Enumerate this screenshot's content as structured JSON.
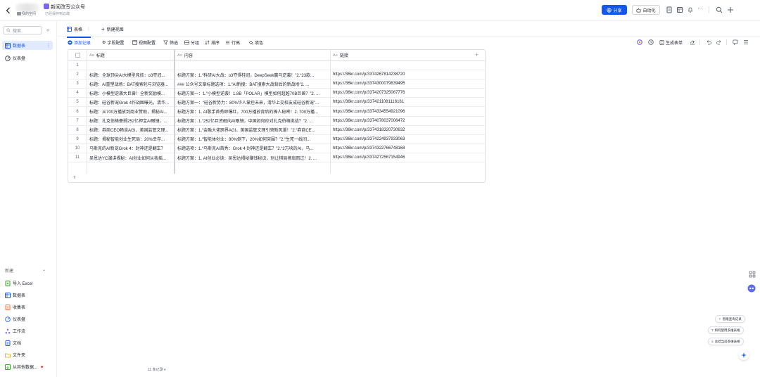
{
  "topbar": {
    "workspace_label": "我的空间",
    "doc_title": "新闻改写公众号",
    "saved_status": "已经保存到云端",
    "share_label": "分享",
    "automation_label": "自动化"
  },
  "sidebar": {
    "search_placeholder": "搜索",
    "items": [
      {
        "label": "数据表",
        "icon": "table-icon",
        "active": true
      },
      {
        "label": "仪表盘",
        "icon": "dashboard-icon",
        "active": false
      }
    ],
    "new_header": "新建",
    "new_items": [
      {
        "label": "导入 Excel",
        "icon": "excel-icon",
        "color": "#2ea121"
      },
      {
        "label": "数据表",
        "icon": "table-icon",
        "color": "#1456f0"
      },
      {
        "label": "收集表",
        "icon": "form-icon",
        "color": "#f77234"
      },
      {
        "label": "仪表盘",
        "icon": "dashboard-icon",
        "color": "#1456f0"
      },
      {
        "label": "工作流",
        "icon": "workflow-icon",
        "color": "#7b67ee"
      },
      {
        "label": "文档",
        "icon": "doc-icon",
        "color": "#1456f0"
      },
      {
        "label": "文件夹",
        "icon": "folder-icon",
        "color": "#f0a000"
      },
      {
        "label": "从其他数据...",
        "icon": "import-icon",
        "color": "#2ea121"
      }
    ]
  },
  "tabs": {
    "active_label": "表格",
    "new_view_label": "新建视图"
  },
  "toolbar": {
    "add_record": "添加记录",
    "field_config": "字段配置",
    "view_config": "视图配置",
    "filter": "筛选",
    "group": "分组",
    "sort": "排序",
    "row_height": "行高",
    "fill_color": "填色",
    "generate_form": "生成表单"
  },
  "table": {
    "columns": [
      {
        "type": "Aa",
        "label": "标题"
      },
      {
        "type": "A≡",
        "label": "内容"
      },
      {
        "type": "A≡",
        "label": "链接"
      }
    ],
    "rows": [
      {
        "num": "1",
        "title": "",
        "content": "",
        "link": ""
      },
      {
        "num": "2",
        "title": "标题：全球顶尖AI大模型竞技：o3夺冠...",
        "content": "标题方案：1.“科研AI大战：o3夺得桂冠，DeepSeek赢马逆袭！”2.“23款...",
        "link": "https://36kr.com/p/3374267814238720"
      },
      {
        "num": "3",
        "title": "标题：AI重塑战场：BAT搜索轮与浏览器...",
        "content": "### 公众号文章标题选项：1.“AI新搜：BAT搜索大战背后的新战场”2. ...",
        "link": "https://36kr.com/p/3374300079839495"
      },
      {
        "num": "4",
        "title": "标题：小模型逆袭大巨兽！全新奖励模...",
        "content": "标题方案一：1.“小模型逆袭！1.8B「POLAR」模型如何超越70B巨兽？”2. ...",
        "link": "https://36kr.com/p/3374207325067776"
      },
      {
        "num": "5",
        "title": "标题：硅谷新宠Grok 4作战图曝光，清华...",
        "content": "标题方案一：“硅谷新势力：80%华人掌控未来，清华上交校友成硅谷新宠”...",
        "link": "https://36kr.com/p/3374211081116161"
      },
      {
        "num": "6",
        "title": "标题：从700万播放到商业赞助，揭秘AI...",
        "content": "标题方案：1. AI歌手首秀即爆红，700万播放背后的捧人秘密！2. 700万播...",
        "link": "https://36kr.com/p/3374334554921096"
      },
      {
        "num": "7",
        "title": "标题：扎克伯格豪掷252亿押宝AI眼镜，...",
        "content": "标题方案：1.“252亿巨资砸向AI眼镜，中国如何应对扎克伯格挑战？”2. ...",
        "link": "https://36kr.com/p/3374078037006472"
      },
      {
        "num": "8",
        "title": "标题：券商CEO畅谈AGI、美国监管文理...",
        "content": "标题方案：1.“金融大佬跨界AGI，美国监管文理引领新风潮！”2.“券商CE...",
        "link": "https://36kr.com/p/3374318320730632"
      },
      {
        "num": "9",
        "title": "标题：揭秘智能创业生死局：20%幸存...",
        "content": "标题方案：1.“智能体创业：80%倒下，20%如何突围？”2.“生死一线间...",
        "link": "https://36kr.com/p/3374224937933063"
      },
      {
        "num": "10",
        "title": "马斯克的AI新宠Grok 4：封神还是翻车？",
        "content": "标题选项：1.“马斯克AI首秀：Grok 4 封神还是翻车？”2.“2万块的AI，马...",
        "link": "https://36kr.com/p/3374322766748168"
      },
      {
        "num": "11",
        "title": "吴恩达YC演讲揭秘：AI创业如何从我摇...",
        "content": "标题方案：1. AI创业必读：吴恩达揭秘赚钱秘诀，别让棋局擦肩而过！2. ...",
        "link": "https://36kr.com/p/3374272567154946"
      }
    ]
  },
  "footer": {
    "record_count": "11 条记录"
  },
  "right_panel": {
    "smart_query": "智能查询记录",
    "how_to_use": "如何使用多维表格",
    "summarize": "总结当前多维表格"
  },
  "colors": {
    "accent": "#1456f0",
    "active_bg": "#e1eaff",
    "border": "#dee0e3"
  }
}
